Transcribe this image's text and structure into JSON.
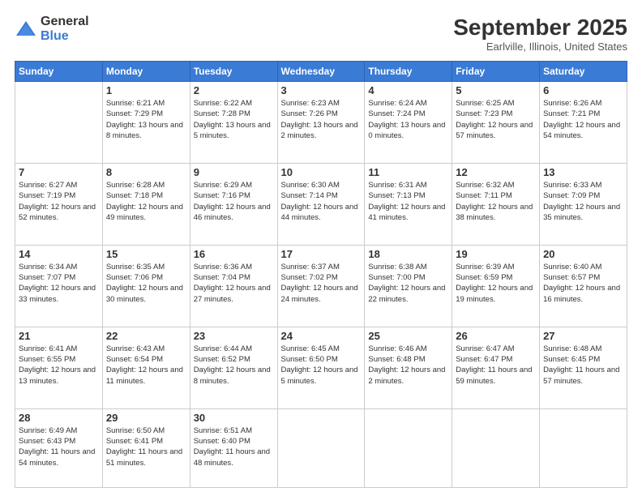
{
  "logo": {
    "general": "General",
    "blue": "Blue"
  },
  "title": "September 2025",
  "subtitle": "Earlville, Illinois, United States",
  "weekdays": [
    "Sunday",
    "Monday",
    "Tuesday",
    "Wednesday",
    "Thursday",
    "Friday",
    "Saturday"
  ],
  "weeks": [
    [
      {
        "day": "",
        "sunrise": "",
        "sunset": "",
        "daylight": ""
      },
      {
        "day": "1",
        "sunrise": "Sunrise: 6:21 AM",
        "sunset": "Sunset: 7:29 PM",
        "daylight": "Daylight: 13 hours and 8 minutes."
      },
      {
        "day": "2",
        "sunrise": "Sunrise: 6:22 AM",
        "sunset": "Sunset: 7:28 PM",
        "daylight": "Daylight: 13 hours and 5 minutes."
      },
      {
        "day": "3",
        "sunrise": "Sunrise: 6:23 AM",
        "sunset": "Sunset: 7:26 PM",
        "daylight": "Daylight: 13 hours and 2 minutes."
      },
      {
        "day": "4",
        "sunrise": "Sunrise: 6:24 AM",
        "sunset": "Sunset: 7:24 PM",
        "daylight": "Daylight: 13 hours and 0 minutes."
      },
      {
        "day": "5",
        "sunrise": "Sunrise: 6:25 AM",
        "sunset": "Sunset: 7:23 PM",
        "daylight": "Daylight: 12 hours and 57 minutes."
      },
      {
        "day": "6",
        "sunrise": "Sunrise: 6:26 AM",
        "sunset": "Sunset: 7:21 PM",
        "daylight": "Daylight: 12 hours and 54 minutes."
      }
    ],
    [
      {
        "day": "7",
        "sunrise": "Sunrise: 6:27 AM",
        "sunset": "Sunset: 7:19 PM",
        "daylight": "Daylight: 12 hours and 52 minutes."
      },
      {
        "day": "8",
        "sunrise": "Sunrise: 6:28 AM",
        "sunset": "Sunset: 7:18 PM",
        "daylight": "Daylight: 12 hours and 49 minutes."
      },
      {
        "day": "9",
        "sunrise": "Sunrise: 6:29 AM",
        "sunset": "Sunset: 7:16 PM",
        "daylight": "Daylight: 12 hours and 46 minutes."
      },
      {
        "day": "10",
        "sunrise": "Sunrise: 6:30 AM",
        "sunset": "Sunset: 7:14 PM",
        "daylight": "Daylight: 12 hours and 44 minutes."
      },
      {
        "day": "11",
        "sunrise": "Sunrise: 6:31 AM",
        "sunset": "Sunset: 7:13 PM",
        "daylight": "Daylight: 12 hours and 41 minutes."
      },
      {
        "day": "12",
        "sunrise": "Sunrise: 6:32 AM",
        "sunset": "Sunset: 7:11 PM",
        "daylight": "Daylight: 12 hours and 38 minutes."
      },
      {
        "day": "13",
        "sunrise": "Sunrise: 6:33 AM",
        "sunset": "Sunset: 7:09 PM",
        "daylight": "Daylight: 12 hours and 35 minutes."
      }
    ],
    [
      {
        "day": "14",
        "sunrise": "Sunrise: 6:34 AM",
        "sunset": "Sunset: 7:07 PM",
        "daylight": "Daylight: 12 hours and 33 minutes."
      },
      {
        "day": "15",
        "sunrise": "Sunrise: 6:35 AM",
        "sunset": "Sunset: 7:06 PM",
        "daylight": "Daylight: 12 hours and 30 minutes."
      },
      {
        "day": "16",
        "sunrise": "Sunrise: 6:36 AM",
        "sunset": "Sunset: 7:04 PM",
        "daylight": "Daylight: 12 hours and 27 minutes."
      },
      {
        "day": "17",
        "sunrise": "Sunrise: 6:37 AM",
        "sunset": "Sunset: 7:02 PM",
        "daylight": "Daylight: 12 hours and 24 minutes."
      },
      {
        "day": "18",
        "sunrise": "Sunrise: 6:38 AM",
        "sunset": "Sunset: 7:00 PM",
        "daylight": "Daylight: 12 hours and 22 minutes."
      },
      {
        "day": "19",
        "sunrise": "Sunrise: 6:39 AM",
        "sunset": "Sunset: 6:59 PM",
        "daylight": "Daylight: 12 hours and 19 minutes."
      },
      {
        "day": "20",
        "sunrise": "Sunrise: 6:40 AM",
        "sunset": "Sunset: 6:57 PM",
        "daylight": "Daylight: 12 hours and 16 minutes."
      }
    ],
    [
      {
        "day": "21",
        "sunrise": "Sunrise: 6:41 AM",
        "sunset": "Sunset: 6:55 PM",
        "daylight": "Daylight: 12 hours and 13 minutes."
      },
      {
        "day": "22",
        "sunrise": "Sunrise: 6:43 AM",
        "sunset": "Sunset: 6:54 PM",
        "daylight": "Daylight: 12 hours and 11 minutes."
      },
      {
        "day": "23",
        "sunrise": "Sunrise: 6:44 AM",
        "sunset": "Sunset: 6:52 PM",
        "daylight": "Daylight: 12 hours and 8 minutes."
      },
      {
        "day": "24",
        "sunrise": "Sunrise: 6:45 AM",
        "sunset": "Sunset: 6:50 PM",
        "daylight": "Daylight: 12 hours and 5 minutes."
      },
      {
        "day": "25",
        "sunrise": "Sunrise: 6:46 AM",
        "sunset": "Sunset: 6:48 PM",
        "daylight": "Daylight: 12 hours and 2 minutes."
      },
      {
        "day": "26",
        "sunrise": "Sunrise: 6:47 AM",
        "sunset": "Sunset: 6:47 PM",
        "daylight": "Daylight: 11 hours and 59 minutes."
      },
      {
        "day": "27",
        "sunrise": "Sunrise: 6:48 AM",
        "sunset": "Sunset: 6:45 PM",
        "daylight": "Daylight: 11 hours and 57 minutes."
      }
    ],
    [
      {
        "day": "28",
        "sunrise": "Sunrise: 6:49 AM",
        "sunset": "Sunset: 6:43 PM",
        "daylight": "Daylight: 11 hours and 54 minutes."
      },
      {
        "day": "29",
        "sunrise": "Sunrise: 6:50 AM",
        "sunset": "Sunset: 6:41 PM",
        "daylight": "Daylight: 11 hours and 51 minutes."
      },
      {
        "day": "30",
        "sunrise": "Sunrise: 6:51 AM",
        "sunset": "Sunset: 6:40 PM",
        "daylight": "Daylight: 11 hours and 48 minutes."
      },
      {
        "day": "",
        "sunrise": "",
        "sunset": "",
        "daylight": ""
      },
      {
        "day": "",
        "sunrise": "",
        "sunset": "",
        "daylight": ""
      },
      {
        "day": "",
        "sunrise": "",
        "sunset": "",
        "daylight": ""
      },
      {
        "day": "",
        "sunrise": "",
        "sunset": "",
        "daylight": ""
      }
    ]
  ]
}
